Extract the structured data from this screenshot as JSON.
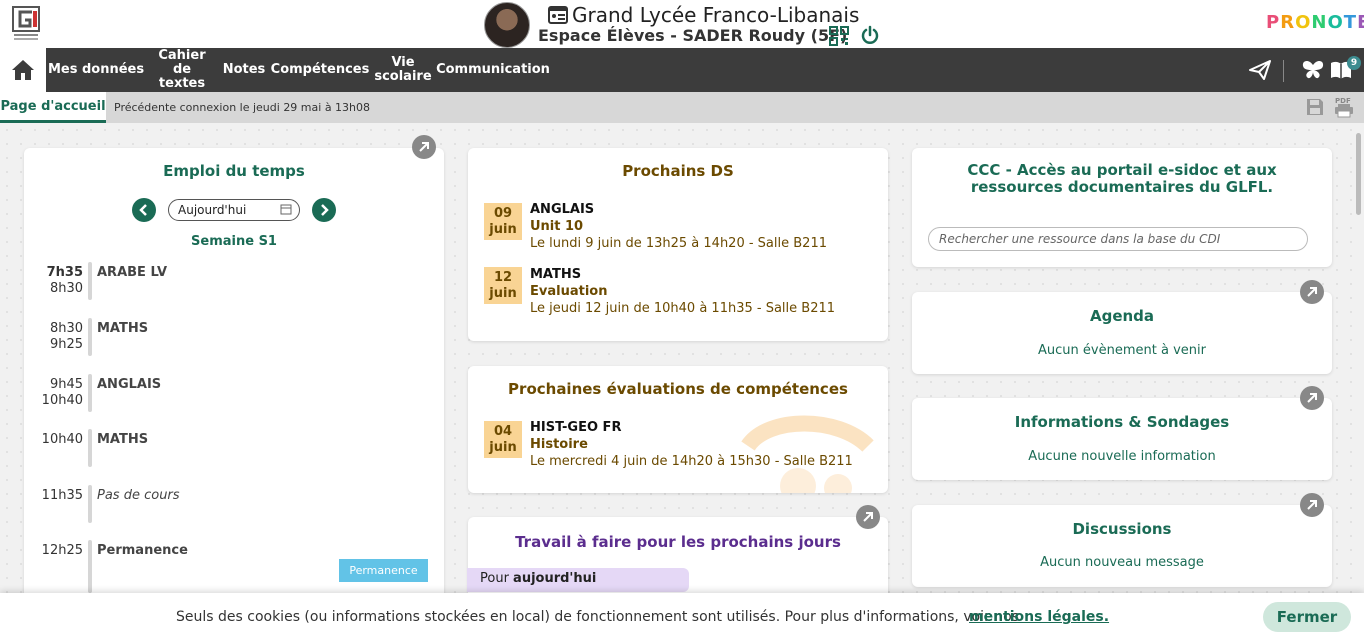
{
  "header": {
    "school_name": "Grand Lycée Franco-Libanais",
    "espace": "Espace Élèves - SADER Roudy (5F)",
    "brand": "PRONOTE",
    "messages_badge": "9"
  },
  "nav": {
    "items": [
      "Mes données",
      "Cahier de textes",
      "Notes",
      "Compétences",
      "Vie scolaire",
      "Communication"
    ]
  },
  "subbar": {
    "tab": "Page d'accueil",
    "previous_connection": "Précédente connexion le jeudi 29 mai à 13h08"
  },
  "edt": {
    "title": "Emploi du temps",
    "date_value": "Aujourd'hui",
    "week": "Semaine S1",
    "slots": [
      {
        "start": "7h35",
        "end": "8h30",
        "subject": "ARABE LV"
      },
      {
        "start": "8h30",
        "end": "9h25",
        "subject": "MATHS"
      },
      {
        "start": "9h45",
        "end": "10h40",
        "subject": "ANGLAIS"
      },
      {
        "start": "10h40",
        "end": "",
        "subject": "MATHS"
      },
      {
        "start": "11h35",
        "end": "",
        "subject": "Pas de cours"
      },
      {
        "start": "12h25",
        "end": "",
        "subject": "Permanence"
      }
    ],
    "perm_tag": "Permanence"
  },
  "ds": {
    "title": "Prochains DS",
    "items": [
      {
        "day": "09",
        "month": "juin",
        "subject": "ANGLAIS",
        "theme": "Unit 10",
        "when": "Le lundi 9 juin de 13h25 à 14h20  - Salle B211"
      },
      {
        "day": "12",
        "month": "juin",
        "subject": "MATHS",
        "theme": "Evaluation",
        "when": "Le jeudi 12 juin de 10h40 à 11h35  - Salle B211"
      }
    ]
  },
  "competences": {
    "title": "Prochaines évaluations de compétences",
    "item": {
      "day": "04",
      "month": "juin",
      "subject": "HIST-GEO FR",
      "theme": "Histoire",
      "when": "Le mercredi 4 juin de 14h20 à 15h30  - Salle B211"
    }
  },
  "travail": {
    "title": "Travail à faire pour les prochains jours",
    "pour_prefix": "Pour ",
    "pour_day": "aujourd'hui"
  },
  "cdi": {
    "title": "CCC - Accès au portail e-sidoc et aux ressources documentaires du GLFL.",
    "search_placeholder": "Rechercher une ressource dans la base du CDI"
  },
  "agenda": {
    "title": "Agenda",
    "empty": "Aucun évènement à venir"
  },
  "infos": {
    "title": "Informations & Sondages",
    "empty": "Aucune nouvelle information"
  },
  "discussions": {
    "title": "Discussions",
    "empty": "Aucun nouveau message"
  },
  "cookie": {
    "text": "Seuls des cookies (ou informations stockées en local) de fonctionnement sont utilisés. Pour plus d'informations, voir nos",
    "link": "mentions légales.",
    "button": "Fermer"
  },
  "colors": {
    "accent_green": "#1a6b55",
    "nav_bg": "#3c3c3c",
    "ds_brown": "#6b4a00",
    "date_box": "#f9d494",
    "travail_purple": "#5b2d8e"
  }
}
